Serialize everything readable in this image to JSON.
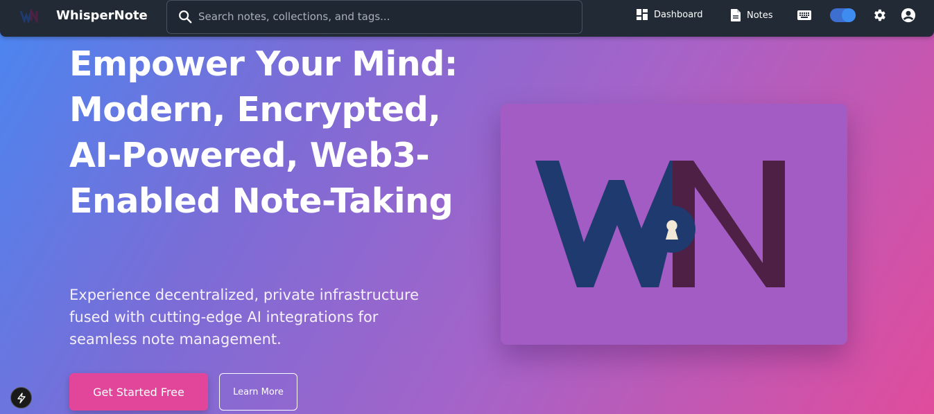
{
  "header": {
    "brand": "WhisperNote",
    "search_placeholder": "Search notes, collections, and tags...",
    "nav": {
      "dashboard": "Dashboard",
      "notes": "Notes"
    },
    "icons": [
      "logo-mark",
      "search-icon",
      "dashboard-icon",
      "document-icon",
      "keyboard-icon",
      "theme-toggle",
      "gear-icon",
      "account-icon"
    ]
  },
  "hero": {
    "title": "Empower Your Mind: Modern, Encrypted, AI-Powered, Web3-Enabled Note-Taking",
    "subtitle": "Experience decentralized, private infrastructure fused with cutting-edge AI integrations for seamless note management.",
    "primary_cta": "Get Started Free",
    "secondary_cta": "Learn More"
  },
  "colors": {
    "header_bg": "#222a36",
    "primary": "#e2469a",
    "card_bg": "#a25cc4",
    "logo_w": "#1e3a6e",
    "logo_n": "#4e2045"
  }
}
